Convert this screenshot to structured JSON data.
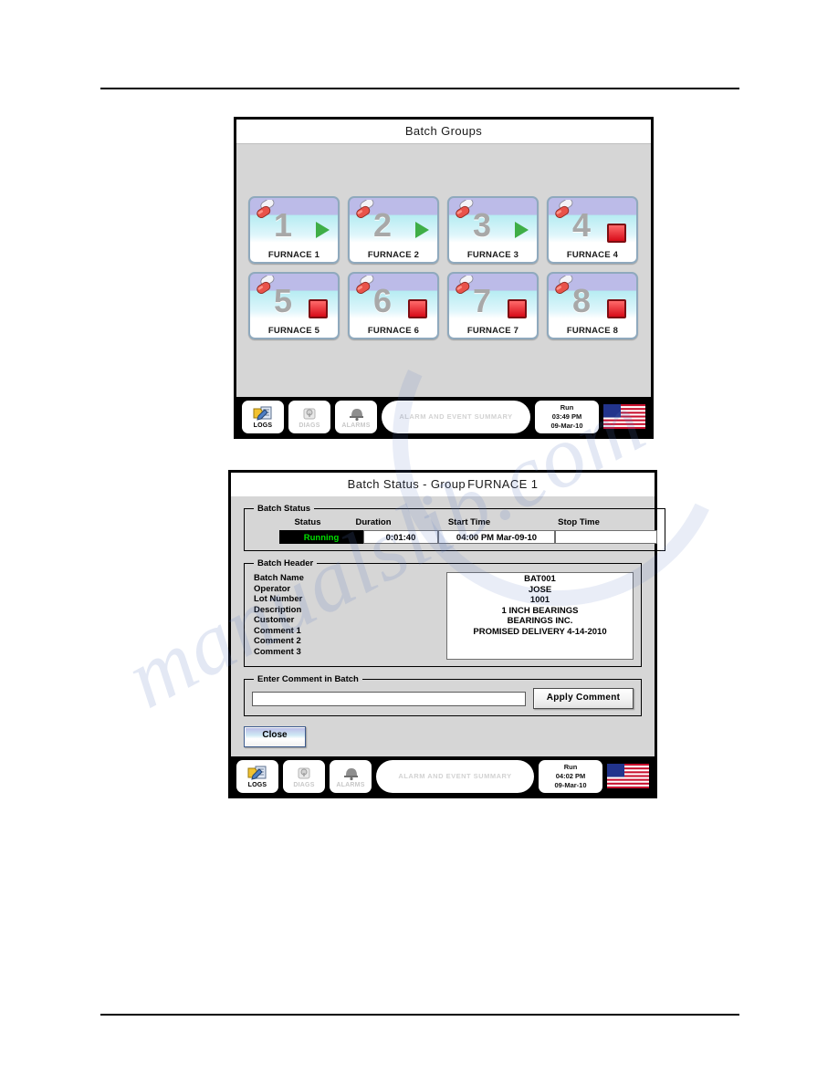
{
  "window_batch_groups": {
    "title_prefix": "Batch Groups",
    "tiles": [
      {
        "number": "1",
        "label": "FURNACE 1",
        "state": "run"
      },
      {
        "number": "2",
        "label": "FURNACE 2",
        "state": "run"
      },
      {
        "number": "3",
        "label": "FURNACE 3",
        "state": "run"
      },
      {
        "number": "4",
        "label": "FURNACE 4",
        "state": "stop"
      },
      {
        "number": "5",
        "label": "FURNACE 5",
        "state": "stop"
      },
      {
        "number": "6",
        "label": "FURNACE 6",
        "state": "stop"
      },
      {
        "number": "7",
        "label": "FURNACE 7",
        "state": "stop"
      },
      {
        "number": "8",
        "label": "FURNACE 8",
        "state": "stop"
      }
    ],
    "toolbar": {
      "logs_label": "LOGS",
      "diags_label": "DIAGS",
      "alarms_label": "ALARMS",
      "alarm_summary": "ALARM AND EVENT SUMMARY",
      "status_mode": "Run",
      "status_time": "03:49 PM",
      "status_date": "09-Mar-10"
    }
  },
  "window_batch_status": {
    "title_prefix": "Batch Status - Group",
    "title_group": "FURNACE 1",
    "batch_status": {
      "legend": "Batch Status",
      "headers": {
        "status": "Status",
        "duration": "Duration",
        "start_time": "Start Time",
        "stop_time": "Stop Time"
      },
      "values": {
        "status": "Running",
        "duration": "0:01:40",
        "start_time": "04:00 PM Mar-09-10",
        "stop_time": ""
      }
    },
    "batch_header": {
      "legend": "Batch Header",
      "labels": [
        "Batch Name",
        "Operator",
        "Lot Number",
        "Description",
        "Customer",
        "Comment 1",
        "Comment 2",
        "Comment 3"
      ],
      "values": [
        "BAT001",
        "JOSE",
        "1001",
        "1 INCH BEARINGS",
        "BEARINGS INC.",
        "PROMISED DELIVERY 4-14-2010",
        "",
        ""
      ]
    },
    "comment_entry": {
      "legend": "Enter Comment in Batch",
      "input_value": "",
      "input_placeholder": "",
      "apply_label": "Apply Comment"
    },
    "close_label": "Close",
    "toolbar": {
      "logs_label": "LOGS",
      "diags_label": "DIAGS",
      "alarms_label": "ALARMS",
      "alarm_summary": "ALARM AND EVENT SUMMARY",
      "status_mode": "Run",
      "status_time": "04:02 PM",
      "status_date": "09-Mar-10"
    }
  },
  "watermark": {
    "text": "manualslib.com"
  },
  "colors": {
    "running_green": "#00e000",
    "stop_red": "#d70b18",
    "run_green": "#3fae47",
    "tile_number_gray": "#a8a8a8",
    "window_body_gray": "#d6d6d6"
  }
}
